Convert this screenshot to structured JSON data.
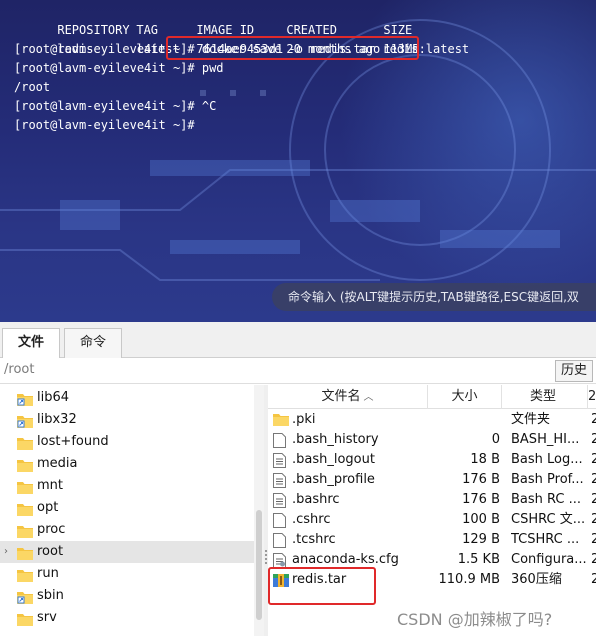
{
  "terminal": {
    "header": [
      "REPOSITORY",
      "TAG",
      "IMAGE ID",
      "CREATED",
      "SIZE"
    ],
    "row": [
      "redis",
      "latest",
      "7614ae9453d1",
      "20 months ago",
      "113MB"
    ],
    "lines": [
      "[root@lavm-eyileve4it ~]# docker save -o redis.tar redis:latest",
      "[root@lavm-eyileve4it ~]# pwd",
      "/root",
      "[root@lavm-eyileve4it ~]# ^C",
      "[root@lavm-eyileve4it ~]#"
    ],
    "command_hint": "命令输入 (按ALT键提示历史,TAB键路径,ESC键返回,双"
  },
  "tabs": [
    {
      "label": "文件",
      "active": true
    },
    {
      "label": "命令",
      "active": false
    }
  ],
  "path": "/root",
  "history_button": "历史",
  "tree": [
    {
      "label": "lib64",
      "icon": "folder-link-icon"
    },
    {
      "label": "libx32",
      "icon": "folder-link-icon"
    },
    {
      "label": "lost+found",
      "icon": "folder-icon"
    },
    {
      "label": "media",
      "icon": "folder-icon"
    },
    {
      "label": "mnt",
      "icon": "folder-icon"
    },
    {
      "label": "opt",
      "icon": "folder-icon"
    },
    {
      "label": "proc",
      "icon": "folder-icon"
    },
    {
      "label": "root",
      "icon": "folder-icon",
      "selected": true,
      "expandable": true
    },
    {
      "label": "run",
      "icon": "folder-icon"
    },
    {
      "label": "sbin",
      "icon": "folder-link-icon"
    },
    {
      "label": "srv",
      "icon": "folder-icon"
    }
  ],
  "columns": {
    "name": "文件名",
    "size": "大小",
    "type": "类型",
    "extra": "2"
  },
  "files": [
    {
      "name": ".pki",
      "size": "",
      "type": "文件夹",
      "extra": "2",
      "icon": "folder-icon"
    },
    {
      "name": ".bash_history",
      "size": "0",
      "type": "BASH_HI...",
      "extra": "2",
      "icon": "blank-file-icon"
    },
    {
      "name": ".bash_logout",
      "size": "18 B",
      "type": "Bash Log...",
      "extra": "2",
      "icon": "text-file-icon"
    },
    {
      "name": ".bash_profile",
      "size": "176 B",
      "type": "Bash Prof...",
      "extra": "2",
      "icon": "text-file-icon"
    },
    {
      "name": ".bashrc",
      "size": "176 B",
      "type": "Bash RC ...",
      "extra": "2",
      "icon": "text-file-icon"
    },
    {
      "name": ".cshrc",
      "size": "100 B",
      "type": "CSHRC 文...",
      "extra": "2",
      "icon": "blank-file-icon"
    },
    {
      "name": ".tcshrc",
      "size": "129 B",
      "type": "TCSHRC ...",
      "extra": "2",
      "icon": "blank-file-icon"
    },
    {
      "name": "anaconda-ks.cfg",
      "size": "1.5 KB",
      "type": "Configura...",
      "extra": "2",
      "icon": "config-file-icon"
    },
    {
      "name": "redis.tar",
      "size": "110.9 MB",
      "type": "360压缩",
      "extra": "2",
      "icon": "archive-icon"
    }
  ],
  "watermark": "CSDN @加辣椒了吗?"
}
